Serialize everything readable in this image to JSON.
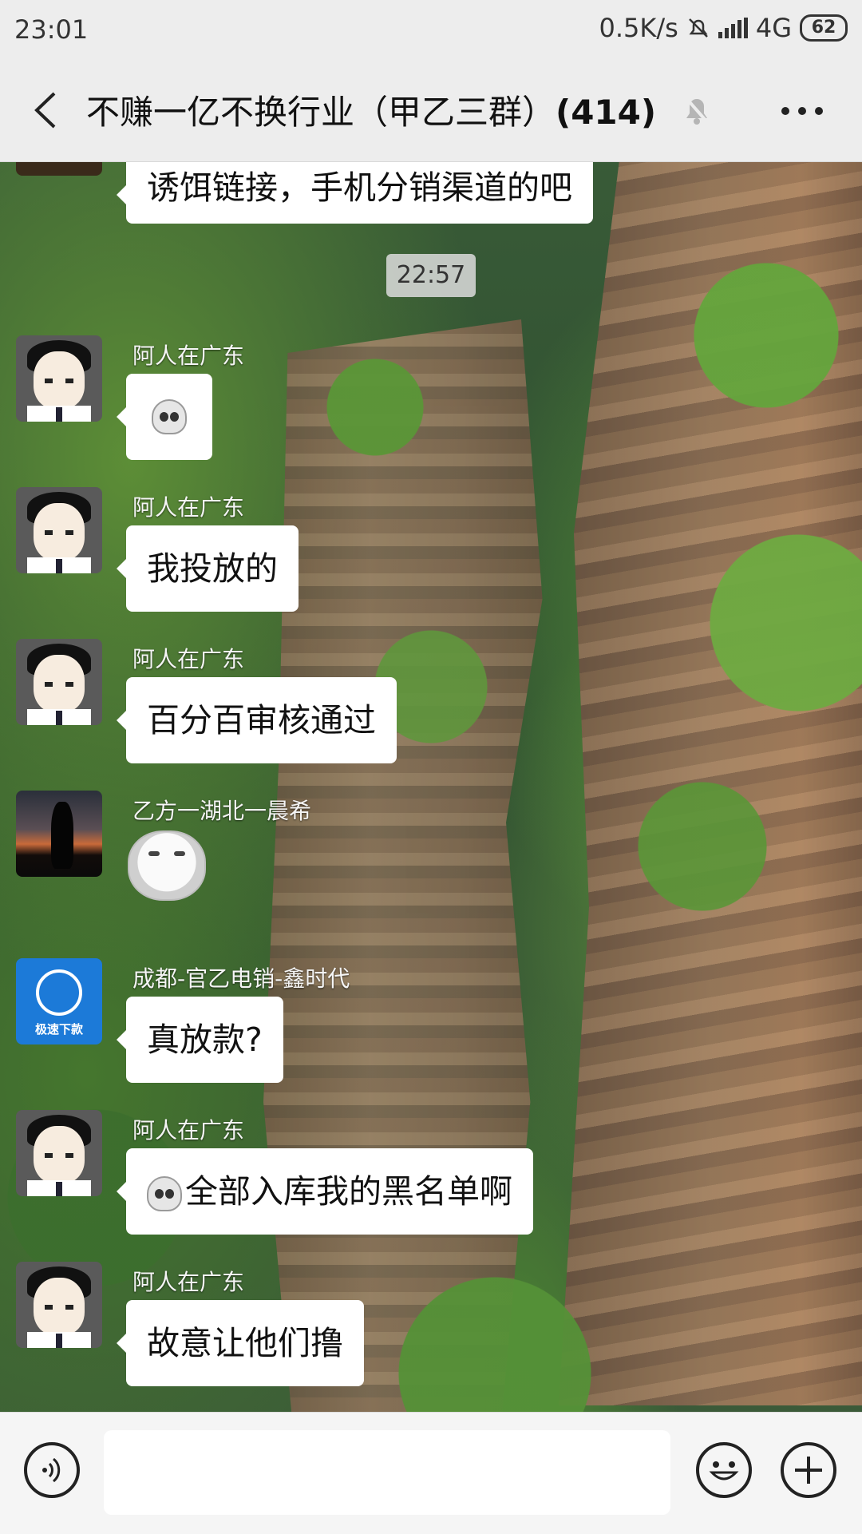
{
  "status_bar": {
    "time": "23:01",
    "net_speed": "0.5K/s",
    "network": "4G",
    "battery": "62"
  },
  "header": {
    "title": "不赚一亿不换行业（甲乙三群）",
    "member_count": "(414)"
  },
  "messages": [
    {
      "type": "partial",
      "text": "诱饵链接，手机分销渠道的吧"
    },
    {
      "type": "time",
      "text": "22:57"
    },
    {
      "sender": "阿人在广东",
      "text": ""
    },
    {
      "sender": "阿人在广东",
      "text": "我投放的"
    },
    {
      "sender": "阿人在广东",
      "text": "百分百审核通过"
    },
    {
      "sender": "乙方一湖北一晨希",
      "text": ""
    },
    {
      "sender": "成都-官乙电销-鑫时代",
      "text": "真放款?",
      "avatar_label": "极速下款"
    },
    {
      "sender": "阿人在广东",
      "text": "全部入库我的黑名单啊"
    },
    {
      "sender": "阿人在广东",
      "text": "故意让他们撸"
    }
  ],
  "input": {
    "placeholder": ""
  }
}
